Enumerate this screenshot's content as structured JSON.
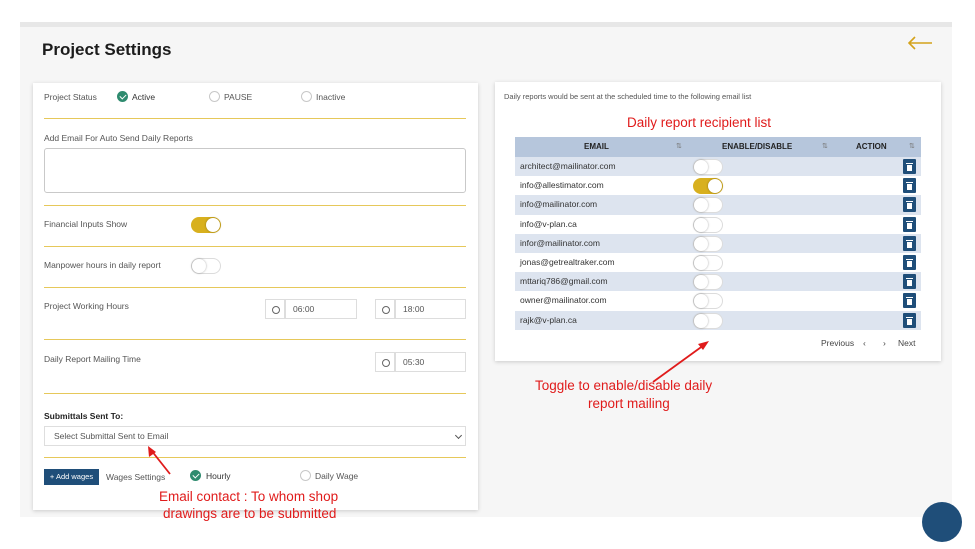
{
  "page_title": "Project Settings",
  "project_status": {
    "label": "Project Status",
    "options": [
      "Active",
      "PAUSE",
      "Inactive"
    ],
    "selected": "Active"
  },
  "auto_email": {
    "label": "Add Email For Auto Send Daily Reports",
    "value": ""
  },
  "financial_inputs": {
    "label": "Financial Inputs Show",
    "enabled": true
  },
  "manpower_hours": {
    "label": "Manpower hours in daily report",
    "enabled": false
  },
  "working_hours": {
    "label": "Project Working Hours",
    "start": "06:00",
    "end": "18:00"
  },
  "mailing_time": {
    "label": "Daily Report Mailing Time",
    "value": "05:30"
  },
  "submittals": {
    "label": "Submittals Sent To:",
    "placeholder": "Select Submittal Sent to Email"
  },
  "wages": {
    "add_button": "+ Add wages",
    "label": "Wages Settings",
    "options": [
      "Hourly",
      "Daily Wage"
    ],
    "selected": "Hourly"
  },
  "recipients": {
    "description": "Daily reports would be sent at the scheduled time to the following email list",
    "columns": [
      "EMAIL",
      "ENABLE/DISABLE",
      "ACTION"
    ],
    "rows": [
      {
        "email": "architect@mailinator.com",
        "enabled": false
      },
      {
        "email": "info@allestimator.com",
        "enabled": true
      },
      {
        "email": "info@mailinator.com",
        "enabled": false
      },
      {
        "email": "info@v-plan.ca",
        "enabled": false
      },
      {
        "email": "infor@mailinator.com",
        "enabled": false
      },
      {
        "email": "jonas@getrealtraker.com",
        "enabled": false
      },
      {
        "email": "mttariq786@gmail.com",
        "enabled": false
      },
      {
        "email": "owner@mailinator.com",
        "enabled": false
      },
      {
        "email": "rajk@v-plan.ca",
        "enabled": false
      }
    ],
    "pagination": {
      "previous": "Previous",
      "prev_glyph": "‹",
      "next_glyph": "›",
      "next": "Next"
    }
  },
  "annotations": {
    "recipient_list": "Daily report recipient list",
    "toggle_line1": "Toggle to enable/disable daily",
    "toggle_line2": "report mailing",
    "email_line1": "Email contact : To whom shop",
    "email_line2": "drawings are to be submitted"
  },
  "colors": {
    "accent_yellow": "#d8b01e",
    "active_green": "#2e8b6f",
    "navy": "#1f4e79",
    "annotation_red": "#e01b1b"
  }
}
